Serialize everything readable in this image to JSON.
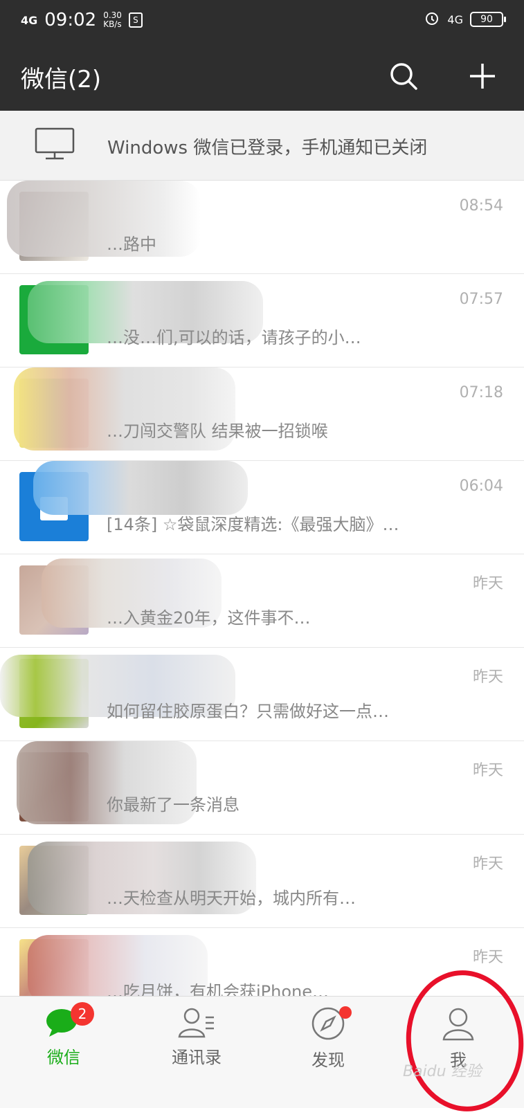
{
  "status_bar": {
    "signal": "4G",
    "time": "09:02",
    "speed_value": "0.30",
    "speed_unit": "KB/s",
    "network": "4G",
    "battery": "90"
  },
  "header": {
    "title": "微信(2)",
    "search_icon": "search-icon",
    "add_icon": "plus-icon"
  },
  "notice": {
    "text": "Windows 微信已登录，手机通知已关闭",
    "icon": "monitor-icon"
  },
  "chats": [
    {
      "time": "08:54",
      "message": "…路中"
    },
    {
      "time": "07:57",
      "message": "…没…们,可以的话，请孩子的小…"
    },
    {
      "time": "07:18",
      "message": "…刀闯交警队 结果被一招锁喉"
    },
    {
      "time": "06:04",
      "message": "[14条] ☆袋鼠深度精选:《最强大脑》…"
    },
    {
      "time": "昨天",
      "message": "…入黄金20年，这件事不…"
    },
    {
      "time": "昨天",
      "message": "如何留住胶原蛋白？只需做好这一点…"
    },
    {
      "time": "昨天",
      "message": "你最新了一条消息"
    },
    {
      "time": "昨天",
      "message": "…天检查从明天开始，城内所有…"
    },
    {
      "time": "昨天",
      "message": "…吃月饼，有机会获iPhone…"
    }
  ],
  "tabbar": {
    "tabs": [
      {
        "label": "微信",
        "badge": "2",
        "icon": "chat-bubble-icon"
      },
      {
        "label": "通讯录",
        "icon": "contacts-icon"
      },
      {
        "label": "发现",
        "icon": "compass-icon"
      },
      {
        "label": "我",
        "icon": "person-icon"
      }
    ]
  },
  "watermark": "Baidu 经验",
  "colors": {
    "header_bg": "#2e2e2e",
    "accent_green": "#1aad19",
    "badge_red": "#f43530",
    "annotation_red": "#e8102a"
  }
}
